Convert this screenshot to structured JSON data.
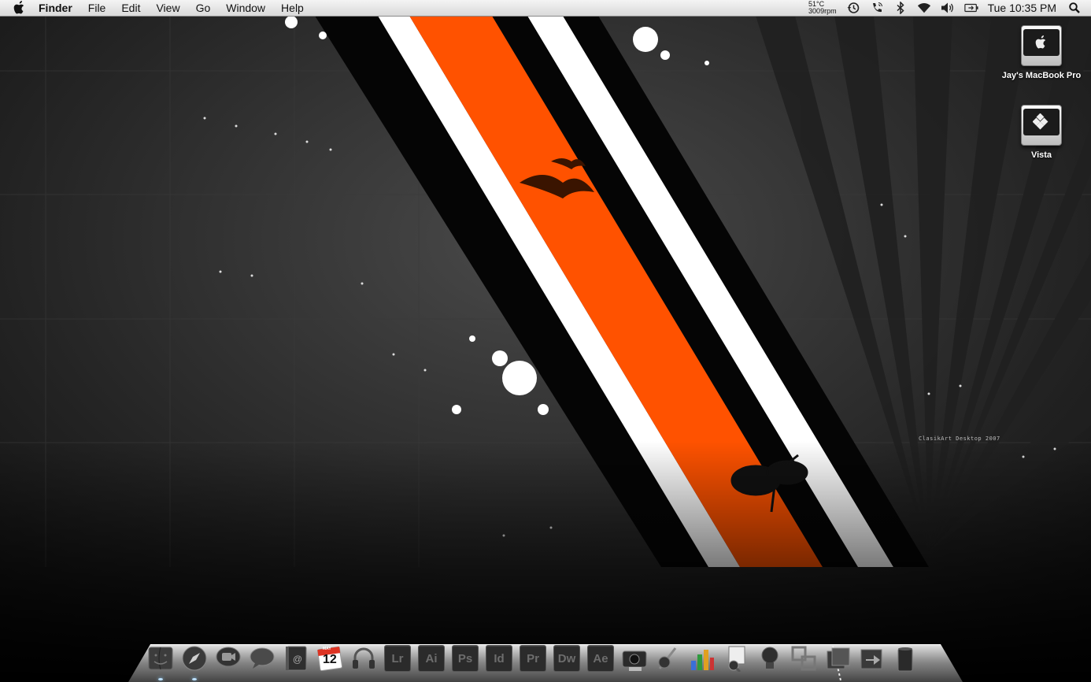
{
  "menubar": {
    "app_name": "Finder",
    "menus": [
      "File",
      "Edit",
      "View",
      "Go",
      "Window",
      "Help"
    ],
    "temperature": "51°C",
    "fan_speed": "3009rpm",
    "clock": "Tue 10:35 PM",
    "status_icons": [
      "time-machine-icon",
      "phone-icon",
      "bluetooth-icon",
      "wifi-icon",
      "volume-icon",
      "battery-icon"
    ]
  },
  "desktop": {
    "icons": [
      {
        "label": "Jay's MacBook Pro",
        "icon": "hard-drive-icon"
      },
      {
        "label": "Vista",
        "icon": "windows-drive-icon"
      }
    ],
    "wallpaper_credit": "ClasikArt Desktop 2007",
    "colors": {
      "accent": "#ff5a00",
      "stripe": "#ffffff",
      "dark": "#0b0b0b"
    }
  },
  "dock": {
    "apps": [
      {
        "name": "finder-icon"
      },
      {
        "name": "safari-icon"
      },
      {
        "name": "ichat-video-icon"
      },
      {
        "name": "ichat-icon"
      },
      {
        "name": "address-book-icon"
      },
      {
        "name": "ical-icon",
        "month": "MAY",
        "day": "12"
      },
      {
        "name": "itunes-icon"
      },
      {
        "name": "lightroom-icon",
        "text": "Lr"
      },
      {
        "name": "illustrator-icon",
        "text": "Ai"
      },
      {
        "name": "photoshop-icon",
        "text": "Ps"
      },
      {
        "name": "indesign-icon",
        "text": "Id"
      },
      {
        "name": "premiere-icon",
        "text": "Pr"
      },
      {
        "name": "dreamweaver-icon",
        "text": "Dw"
      },
      {
        "name": "after-effects-icon",
        "text": "Ae"
      },
      {
        "name": "camera-icon"
      },
      {
        "name": "script-editor-icon"
      },
      {
        "name": "charts-icon"
      },
      {
        "name": "preview-icon"
      },
      {
        "name": "lightbulb-icon"
      },
      {
        "name": "migration-icon"
      },
      {
        "name": "documents-stack-icon"
      },
      {
        "name": "downloads-stack-icon"
      },
      {
        "name": "trash-icon"
      }
    ]
  }
}
